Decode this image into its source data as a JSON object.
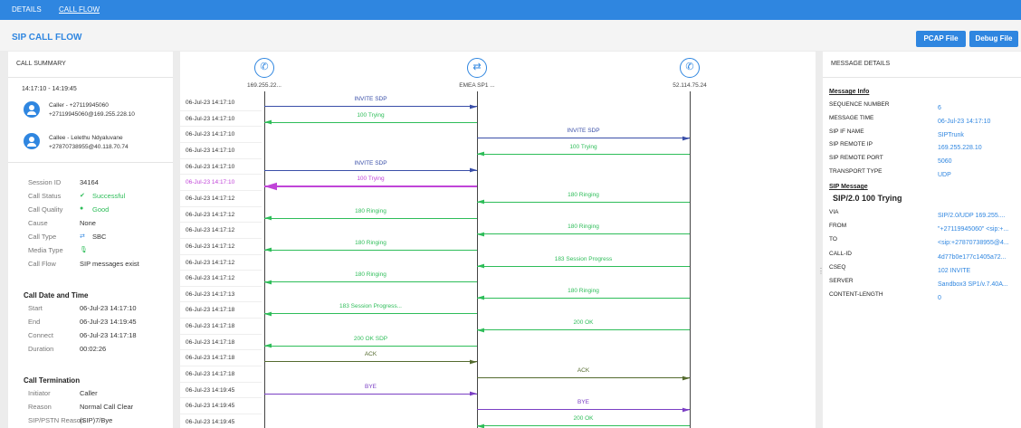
{
  "nav": {
    "tabs": [
      {
        "label": "DETAILS"
      },
      {
        "label": "CALL FLOW"
      }
    ]
  },
  "page": {
    "title": "SIP CALL FLOW",
    "pcap_button": "PCAP File",
    "debug_button": "Debug File"
  },
  "summary": {
    "header": "CALL SUMMARY",
    "time_range": "14:17:10 - 14:19:45",
    "caller": {
      "line1": "Caller - +27119945060",
      "line2": "+27119945060@169.255.228.10"
    },
    "callee": {
      "line1": "Callee - Lelethu Ndyaluvane",
      "line2": "+27870738955@40.118.70.74"
    },
    "fields": [
      {
        "label": "Session ID",
        "value": "34164",
        "icon": ""
      },
      {
        "label": "Call Status",
        "value": "Successful",
        "icon": "check-circle-icon"
      },
      {
        "label": "Call Quality",
        "value": "Good",
        "icon": "dot-icon"
      },
      {
        "label": "Cause",
        "value": "None",
        "icon": ""
      },
      {
        "label": "Call Type",
        "value": "SBC",
        "icon": "sbc-icon"
      },
      {
        "label": "Media Type",
        "value": "",
        "icon": "microphone-icon"
      },
      {
        "label": "Call Flow",
        "value": "SIP messages exist",
        "icon": ""
      }
    ],
    "date_section": {
      "title": "Call Date and Time",
      "rows": [
        {
          "label": "Start",
          "value": "06-Jul-23 14:17:10"
        },
        {
          "label": "End",
          "value": "06-Jul-23 14:19:45"
        },
        {
          "label": "Connect",
          "value": "06-Jul-23 14:17:18"
        },
        {
          "label": "Duration",
          "value": "00:02:26"
        }
      ]
    },
    "termination": {
      "title": "Call Termination",
      "rows": [
        {
          "label": "Initiator",
          "value": "Caller"
        },
        {
          "label": "Reason",
          "value": "Normal Call Clear"
        },
        {
          "label": "SIP/PSTN Reason",
          "value": "(SIP)7/Bye"
        }
      ]
    }
  },
  "flow": {
    "endpoints": [
      {
        "label": "169.255.22...",
        "icon": "phone-icon"
      },
      {
        "label": "EMEA SP1 ...",
        "icon": "sbc-icon"
      },
      {
        "label": "52.114.75.24",
        "icon": "phone-icon"
      }
    ],
    "messages": [
      {
        "time": "06-Jul-23 14:17:10",
        "label": "INVITE SDP",
        "from": 0,
        "to": 1,
        "color": "#3a4fa8",
        "highlight": false
      },
      {
        "time": "06-Jul-23 14:17:10",
        "label": "100 Trying",
        "from": 1,
        "to": 0,
        "color": "#2ebd59",
        "highlight": false
      },
      {
        "time": "06-Jul-23 14:17:10",
        "label": "INVITE SDP",
        "from": 1,
        "to": 2,
        "color": "#3a4fa8",
        "highlight": false
      },
      {
        "time": "06-Jul-23 14:17:10",
        "label": "100 Trying",
        "from": 2,
        "to": 1,
        "color": "#2ebd59",
        "highlight": false
      },
      {
        "time": "06-Jul-23 14:17:10",
        "label": "INVITE SDP",
        "from": 0,
        "to": 1,
        "color": "#3a4fa8",
        "highlight": false
      },
      {
        "time": "06-Jul-23 14:17:10",
        "label": "100 Trying",
        "from": 1,
        "to": 0,
        "color": "#c044d8",
        "highlight": true
      },
      {
        "time": "06-Jul-23 14:17:12",
        "label": "180 Ringing",
        "from": 2,
        "to": 1,
        "color": "#2ebd59",
        "highlight": false
      },
      {
        "time": "06-Jul-23 14:17:12",
        "label": "180 Ringing",
        "from": 1,
        "to": 0,
        "color": "#2ebd59",
        "highlight": false
      },
      {
        "time": "06-Jul-23 14:17:12",
        "label": "180 Ringing",
        "from": 2,
        "to": 1,
        "color": "#2ebd59",
        "highlight": false
      },
      {
        "time": "06-Jul-23 14:17:12",
        "label": "180 Ringing",
        "from": 1,
        "to": 0,
        "color": "#2ebd59",
        "highlight": false
      },
      {
        "time": "06-Jul-23 14:17:12",
        "label": "183 Session Progress",
        "from": 2,
        "to": 1,
        "color": "#2ebd59",
        "highlight": false
      },
      {
        "time": "06-Jul-23 14:17:12",
        "label": "180 Ringing",
        "from": 1,
        "to": 0,
        "color": "#2ebd59",
        "highlight": false
      },
      {
        "time": "06-Jul-23 14:17:13",
        "label": "180 Ringing",
        "from": 2,
        "to": 1,
        "color": "#2ebd59",
        "highlight": false
      },
      {
        "time": "06-Jul-23 14:17:18",
        "label": "183 Session Progress...",
        "from": 1,
        "to": 0,
        "color": "#2ebd59",
        "highlight": false
      },
      {
        "time": "06-Jul-23 14:17:18",
        "label": "200 OK",
        "from": 2,
        "to": 1,
        "color": "#2ebd59",
        "highlight": false
      },
      {
        "time": "06-Jul-23 14:17:18",
        "label": "200 OK SDP",
        "from": 1,
        "to": 0,
        "color": "#2ebd59",
        "highlight": false
      },
      {
        "time": "06-Jul-23 14:17:18",
        "label": "ACK",
        "from": 0,
        "to": 1,
        "color": "#556b2f",
        "highlight": false
      },
      {
        "time": "06-Jul-23 14:17:18",
        "label": "ACK",
        "from": 1,
        "to": 2,
        "color": "#556b2f",
        "highlight": false
      },
      {
        "time": "06-Jul-23 14:19:45",
        "label": "BYE",
        "from": 0,
        "to": 1,
        "color": "#7b3fc4",
        "highlight": false
      },
      {
        "time": "06-Jul-23 14:19:45",
        "label": "BYE",
        "from": 1,
        "to": 2,
        "color": "#7b3fc4",
        "highlight": false
      },
      {
        "time": "06-Jul-23 14:19:45",
        "label": "200 OK",
        "from": 2,
        "to": 1,
        "color": "#2ebd59",
        "highlight": false
      }
    ]
  },
  "details": {
    "header": "MESSAGE DETAILS",
    "info_title": "Message Info",
    "info_rows": [
      {
        "label": "SEQUENCE NUMBER",
        "value": "6"
      },
      {
        "label": "MESSAGE TIME",
        "value": "06-Jul-23 14:17:10"
      },
      {
        "label": "SIP IF NAME",
        "value": "SIPTrunk"
      },
      {
        "label": "SIP REMOTE IP",
        "value": "169.255.228.10"
      },
      {
        "label": "SIP REMOTE PORT",
        "value": "5060"
      },
      {
        "label": "TRANSPORT TYPE",
        "value": "UDP"
      }
    ],
    "sip_title": "SIP Message",
    "sip_status": "SIP/2.0 100 Trying",
    "sip_rows": [
      {
        "label": "VIA",
        "value": "SIP/2.0/UDP 169.255...."
      },
      {
        "label": "FROM",
        "value": "\"+27119945060\" <sip:+..."
      },
      {
        "label": "TO",
        "value": "<sip:+27870738955@4..."
      },
      {
        "label": "CALL-ID",
        "value": "4d77b0e177c1405a72..."
      },
      {
        "label": "CSEQ",
        "value": "102 INVITE"
      },
      {
        "label": "SERVER",
        "value": "Sandbox3 SP1/v.7.40A..."
      },
      {
        "label": "CONTENT-LENGTH",
        "value": "0"
      }
    ]
  }
}
